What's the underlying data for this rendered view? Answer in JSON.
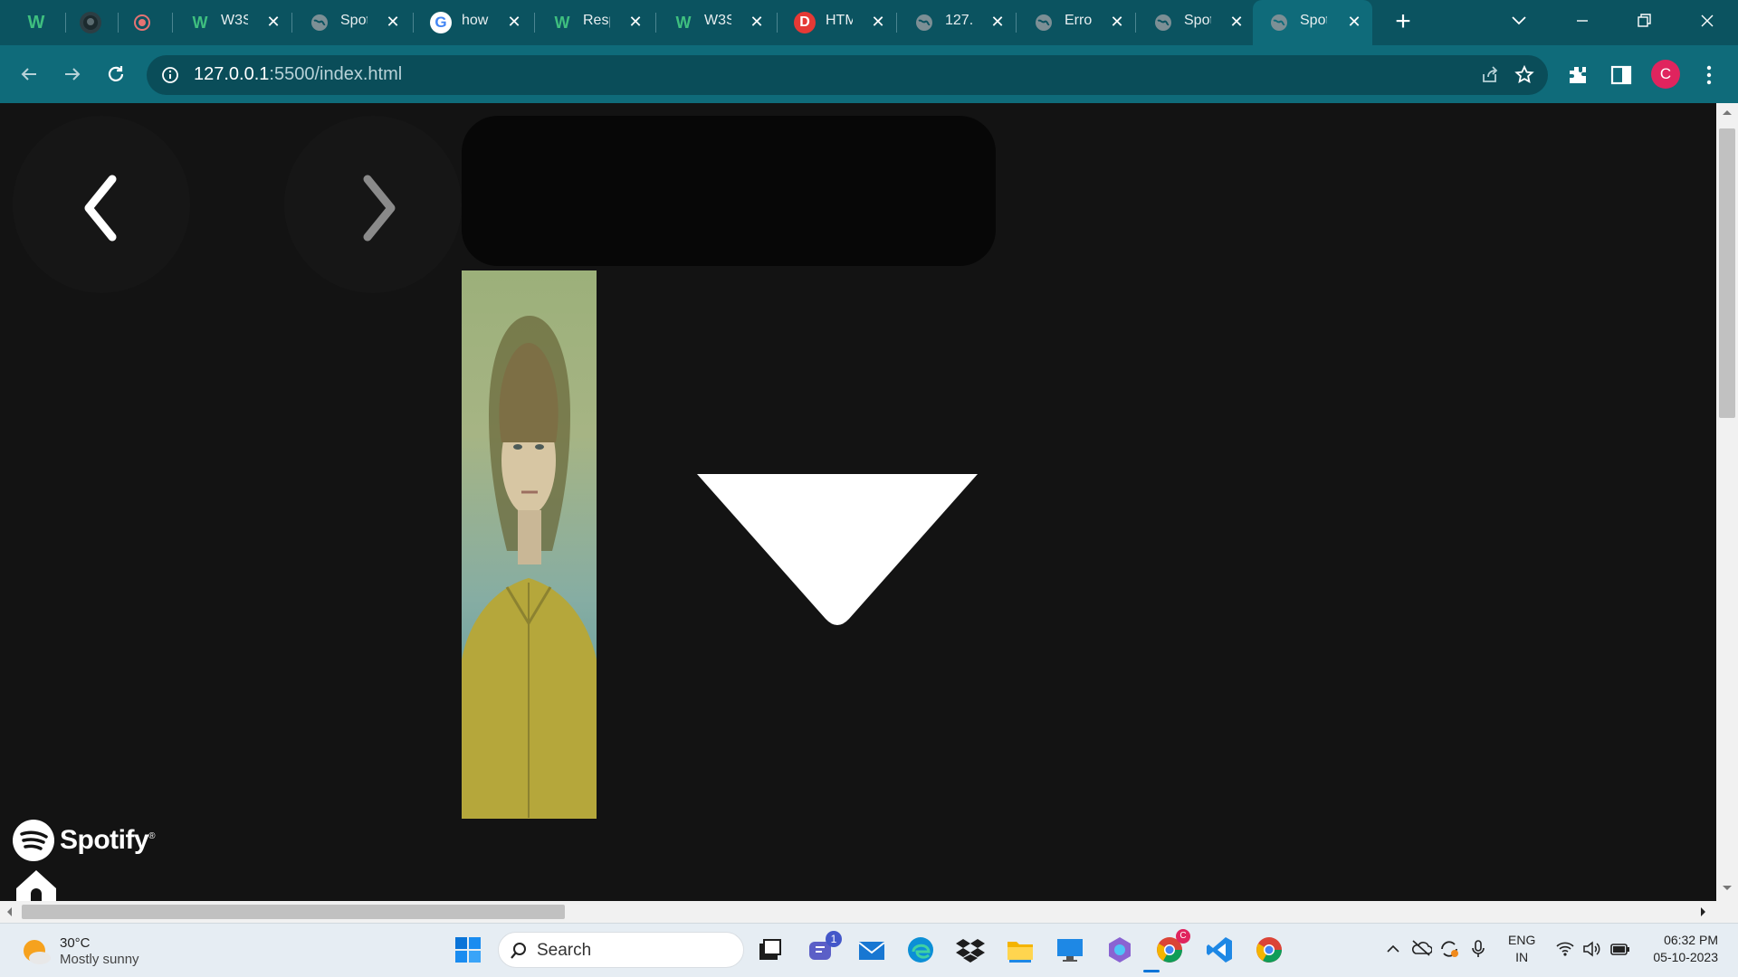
{
  "browser": {
    "tabs": [
      {
        "title": "",
        "icon": "w3schools-icon",
        "closable": false
      },
      {
        "title": "",
        "icon": "github-icon",
        "closable": false
      },
      {
        "title": "",
        "icon": "record-icon",
        "closable": false
      },
      {
        "title": "W3S",
        "icon": "w3schools-icon",
        "closable": true
      },
      {
        "title": "Spot",
        "icon": "globe-icon",
        "closable": true
      },
      {
        "title": "how",
        "icon": "google-icon",
        "closable": true
      },
      {
        "title": "Resp",
        "icon": "w3schools-icon",
        "closable": true
      },
      {
        "title": "W3S",
        "icon": "w3schools-icon",
        "closable": true
      },
      {
        "title": "HTM",
        "icon": "d-icon",
        "closable": true
      },
      {
        "title": "127.",
        "icon": "globe-icon",
        "closable": true
      },
      {
        "title": "Error",
        "icon": "globe-icon",
        "closable": true
      },
      {
        "title": "Spot",
        "icon": "globe-icon",
        "closable": true
      },
      {
        "title": "Spot",
        "icon": "globe-icon",
        "closable": true,
        "active": true
      }
    ],
    "url_host": "127.0.0.1",
    "url_rest": ":5500/index.html",
    "profile_initial": "C"
  },
  "page": {
    "brand": "Spotify",
    "brand_mark": "®"
  },
  "taskbar": {
    "weather_temp": "30°C",
    "weather_desc": "Mostly sunny",
    "search_placeholder": "Search",
    "teams_badge": "1",
    "lang": "ENG",
    "region": "IN",
    "time": "06:32 PM",
    "date": "05-10-2023"
  },
  "colors": {
    "tabbar": "#0b5360",
    "toolbar": "#0f6b7a",
    "page_bg": "#131313",
    "accent_profile": "#e0245e"
  }
}
